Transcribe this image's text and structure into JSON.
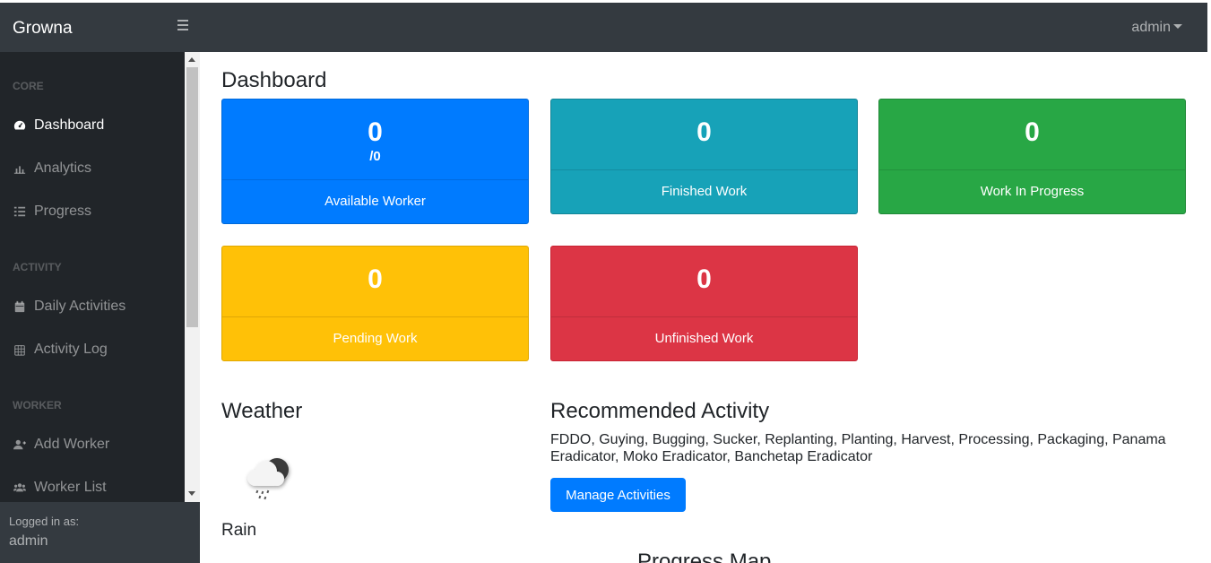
{
  "topbar": {
    "brand": "Growna",
    "user": "admin"
  },
  "sidebar": {
    "headings": {
      "core": "CORE",
      "activity": "ACTIVITY",
      "worker": "WORKER"
    },
    "items": [
      {
        "label": "Dashboard",
        "icon": "tachometer-icon",
        "active": true
      },
      {
        "label": "Analytics",
        "icon": "chart-bar-icon",
        "active": false
      },
      {
        "label": "Progress",
        "icon": "tasks-icon",
        "active": false
      },
      {
        "label": "Daily Activities",
        "icon": "calendar-icon",
        "active": false
      },
      {
        "label": "Activity Log",
        "icon": "calendar-grid-icon",
        "active": false
      },
      {
        "label": "Add Worker",
        "icon": "user-plus-icon",
        "active": false
      },
      {
        "label": "Worker List",
        "icon": "users-icon",
        "active": false
      }
    ],
    "footer": {
      "label": "Logged in as:",
      "user": "admin"
    }
  },
  "main": {
    "title": "Dashboard",
    "cards": [
      {
        "value": "0",
        "sub": "/0",
        "label": "Available Worker",
        "color": "#007bff"
      },
      {
        "value": "0",
        "label": "Finished Work",
        "color": "#17a2b8"
      },
      {
        "value": "0",
        "label": "Work In Progress",
        "color": "#28a745"
      },
      {
        "value": "0",
        "label": "Pending Work",
        "color": "#ffc107"
      },
      {
        "value": "0",
        "label": "Unfinished Work",
        "color": "#dc3545"
      }
    ],
    "weather": {
      "title": "Weather",
      "condition": "Rain",
      "icon": "rain-cloud-icon"
    },
    "recommended": {
      "title": "Recommended Activity",
      "text": "FDDO, Guying, Bugging, Sucker, Replanting, Planting, Harvest, Processing, Packaging, Panama Eradicator, Moko Eradicator, Banchetap Eradicator",
      "button": "Manage Activities"
    },
    "map_title": "Progress Map"
  }
}
